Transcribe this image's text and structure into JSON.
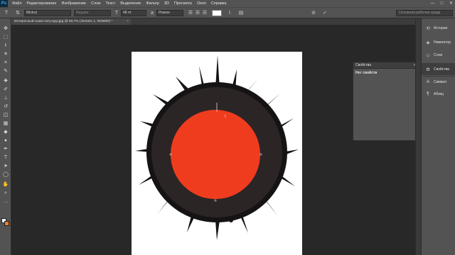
{
  "app": {
    "logo": "Ps"
  },
  "menu": [
    "Файл",
    "Редактирование",
    "Изображение",
    "Слои",
    "Текст",
    "Выделение",
    "Фильтр",
    "3D",
    "Просмотр",
    "Окно",
    "Справка"
  ],
  "window_controls": {
    "minimize": "—",
    "maximize": "□",
    "close": "✕"
  },
  "options": {
    "font_family": "Mistral",
    "font_style": "Regular",
    "font_size": "48 пт",
    "antialias": "Резкое",
    "text_color": "#ffffff",
    "workspace": "Основная рабочая среда"
  },
  "document": {
    "tab_title": "Интересный-эскиз-тату-круг.jpg @ 66,7% (Эллипс 1, RGB/8#) *"
  },
  "colors": {
    "foreground": "#ffffff",
    "background": "#f07a2a",
    "circle_fill": "#f03c1e",
    "ring": "#2b2526"
  },
  "properties": {
    "title": "Свойства",
    "empty_text": "Нет свойств"
  },
  "dock": [
    {
      "icon": "history-icon",
      "label": "История"
    },
    {
      "icon": "navigator-icon",
      "label": "Навигатор"
    },
    {
      "icon": "layers-icon",
      "label": "Слои"
    },
    {
      "icon": "properties-icon",
      "label": "Свойства"
    },
    {
      "icon": "character-icon",
      "label": "Символ"
    },
    {
      "icon": "paragraph-icon",
      "label": "Абзац"
    }
  ]
}
